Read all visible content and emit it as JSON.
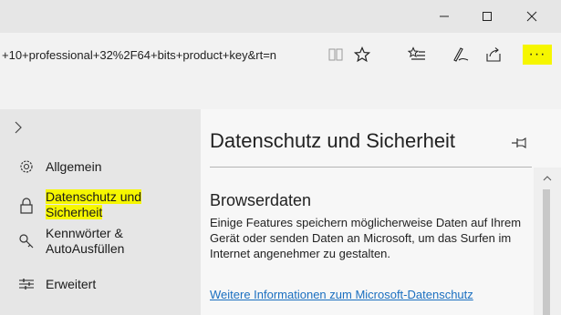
{
  "window": {
    "minimize_icon": "minimize-icon",
    "maximize_icon": "maximize-icon",
    "close_icon": "close-icon"
  },
  "address_bar": {
    "url_text": "+10+professional+32%2F64+bits+product+key&rt=n"
  },
  "toolbar_icons": {
    "reading_view": "book-icon",
    "favorite": "star-icon",
    "favorites_hub": "favorites-list-icon",
    "notes": "pen-icon",
    "share": "share-icon",
    "more": "···"
  },
  "colors": {
    "highlight": "#f6f600",
    "link": "#1a6fc0",
    "nav_bg": "#e6e6e6",
    "panel_bg": "#f7f7f7"
  },
  "nav": {
    "items": [
      {
        "label": "Allgemein",
        "icon": "gear-icon"
      },
      {
        "label_line1": "Datenschutz und",
        "label_line2": "Sicherheit",
        "icon": "lock-icon",
        "active": true
      },
      {
        "label_line1": "Kennwörter &",
        "label_line2": "AutoAusfüllen",
        "icon": "key-icon"
      },
      {
        "label": "Erweitert",
        "icon": "sliders-icon"
      }
    ]
  },
  "panel": {
    "title": "Datenschutz und Sicherheit",
    "section_title": "Browserdaten",
    "section_text": "Einige Features speichern möglicherweise Daten auf Ihrem Gerät oder senden Daten an Microsoft, um das Surfen im Internet angenehmer zu gestalten.",
    "link_text": "Weitere Informationen zum Microsoft-Datenschutz"
  }
}
